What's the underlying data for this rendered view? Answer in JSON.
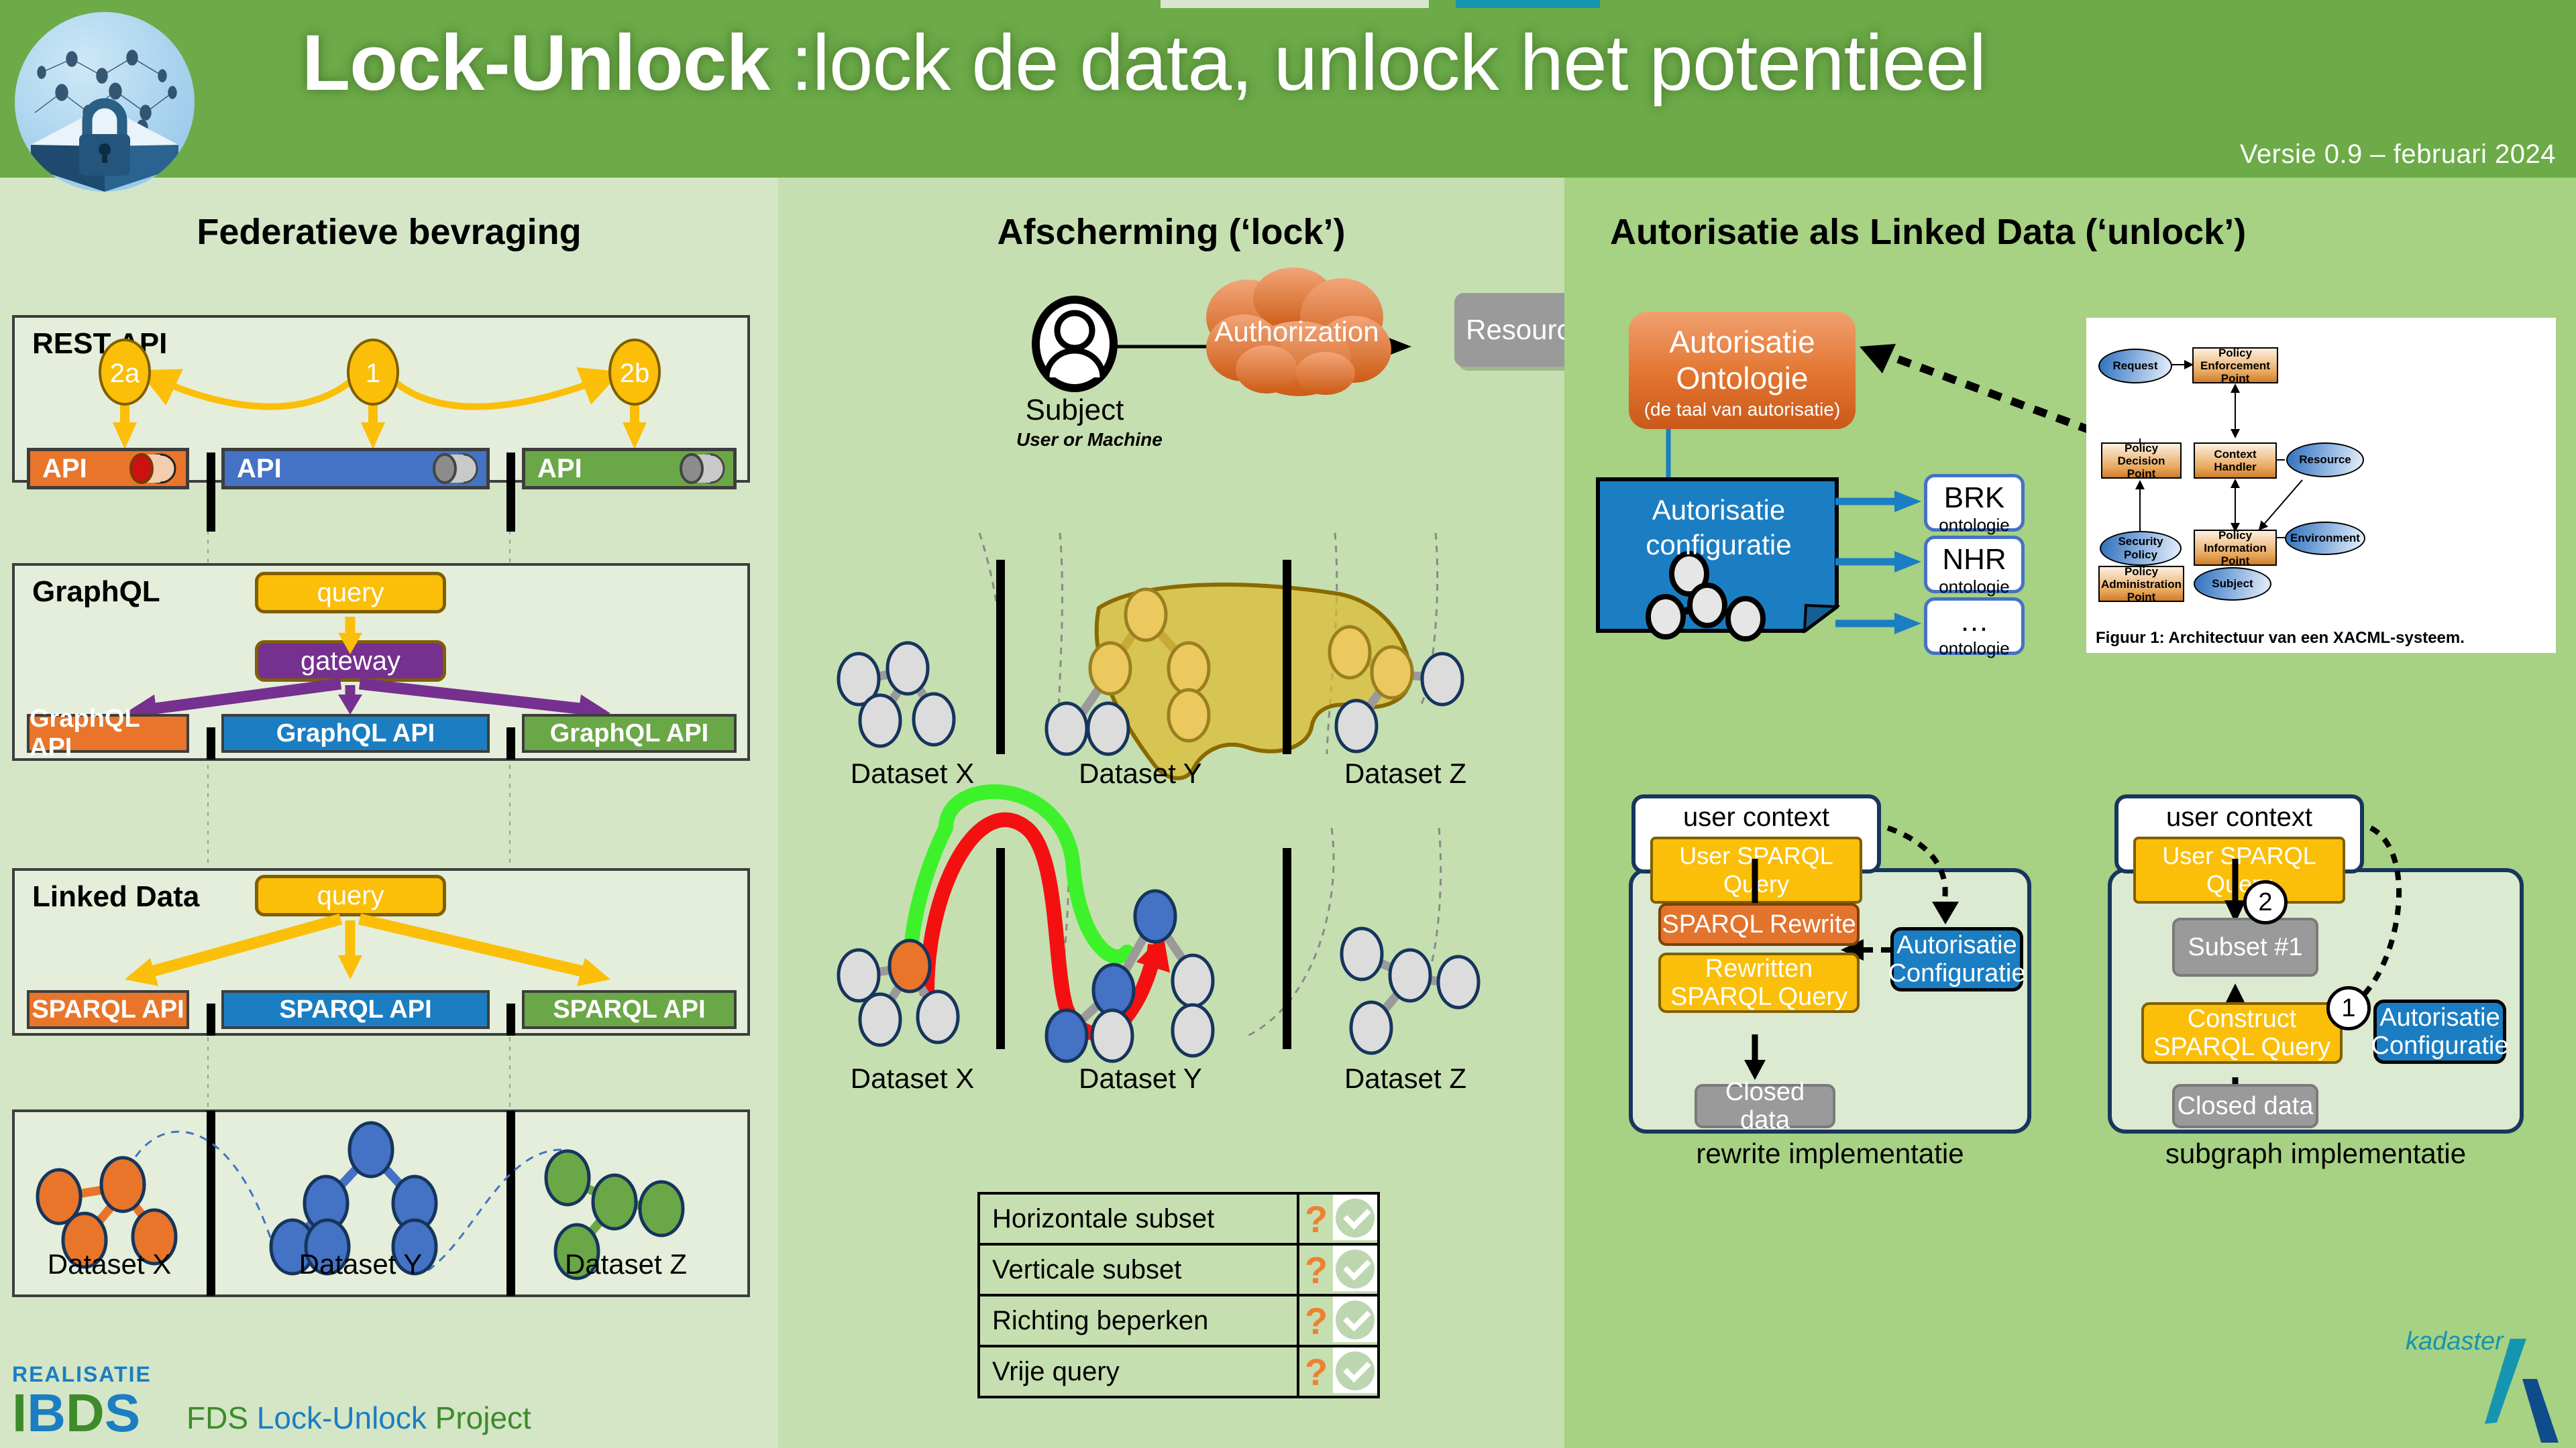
{
  "header": {
    "title_bold": "Lock-Unlock",
    "title_rest": " :lock de data, unlock het potentieel",
    "version": "Versie 0.9 – februari 2024",
    "logo_icon": "padlock-network-icon"
  },
  "columns": {
    "left": {
      "title": "Federatieve bevraging"
    },
    "mid": {
      "title": "Afscherming (‘lock’)"
    },
    "right": {
      "title": "Autorisatie als Linked Data (‘unlock’)"
    }
  },
  "rest_api": {
    "label": "REST API",
    "steps": [
      "2a",
      "1",
      "2b"
    ],
    "apis": [
      {
        "label": "API",
        "color": "#e8752a",
        "toggle": "red"
      },
      {
        "label": "API",
        "color": "#4472c4",
        "toggle": "grey"
      },
      {
        "label": "API",
        "color": "#6aa746",
        "toggle": "grey"
      }
    ]
  },
  "graphql": {
    "label": "GraphQL",
    "query": "query",
    "gateway": "gateway",
    "apis": [
      "GraphQL API",
      "GraphQL API",
      "GraphQL API"
    ]
  },
  "linked_data": {
    "label": "Linked Data",
    "query": "query",
    "apis": [
      "SPARQL API",
      "SPARQL API",
      "SPARQL API"
    ]
  },
  "datasets": {
    "labels": [
      "Dataset X",
      "Dataset Y",
      "Dataset Z"
    ],
    "colors": [
      "#e8752a",
      "#4472c4",
      "#6aa746"
    ]
  },
  "afscherming": {
    "subject": "Subject",
    "subject_sub": "User or Machine",
    "authorization": "Authorization",
    "resource": "Resource",
    "subject_icon": "person-avatar-icon",
    "cloud_icon": "cloud-icon"
  },
  "features_table": {
    "rows": [
      {
        "label": "Horizontale subset",
        "question": "?",
        "check": "✓"
      },
      {
        "label": "Verticale subset",
        "question": "?",
        "check": "✓"
      },
      {
        "label": "Richting beperken",
        "question": "?",
        "check": "✓"
      },
      {
        "label": "Vrije query",
        "question": "?",
        "check": "✓"
      }
    ]
  },
  "unlock": {
    "ontology_title_line1": "Autorisatie",
    "ontology_title_line2": "Ontologie",
    "ontology_sub": "(de taal van autorisatie)",
    "config_line1": "Autorisatie",
    "config_line2": "configuratie",
    "config_icon": "graph-nodes-icon",
    "ontologies": [
      {
        "name": "BRK",
        "sub": "ontologie"
      },
      {
        "name": "NHR",
        "sub": "ontologie"
      },
      {
        "name": "…",
        "sub": "ontologie"
      }
    ]
  },
  "xacml": {
    "caption": "Figuur 1: Architectuur van een XACML-systeem.",
    "nodes": [
      {
        "id": "request",
        "label": "Request",
        "shape": "ellipse"
      },
      {
        "id": "pep",
        "label": "Policy Enforcement Point",
        "shape": "box"
      },
      {
        "id": "pdp",
        "label": "Policy Decision Point",
        "shape": "box"
      },
      {
        "id": "ctx",
        "label": "Context Handler",
        "shape": "box"
      },
      {
        "id": "resource",
        "label": "Resource",
        "shape": "ellipse"
      },
      {
        "id": "secpol",
        "label": "Security Policy",
        "shape": "ellipse"
      },
      {
        "id": "pip",
        "label": "Policy Information Point",
        "shape": "box"
      },
      {
        "id": "env",
        "label": "Environment",
        "shape": "ellipse"
      },
      {
        "id": "pap",
        "label": "Policy Administration Point",
        "shape": "box"
      },
      {
        "id": "subject",
        "label": "Subject",
        "shape": "ellipse"
      }
    ]
  },
  "rewrite": {
    "user_context": "user context",
    "user_query": "User SPARQL Query",
    "step_boxes": [
      "SPARQL Rewrite",
      "Rewritten\nSPARQL Query",
      "Closed data"
    ],
    "rewrite_label": "SPARQL Rewrite",
    "rewritten_label_l1": "Rewritten",
    "rewritten_label_l2": "SPARQL Query",
    "closed_data": "Closed data",
    "auth_config_l1": "Autorisatie",
    "auth_config_l2": "Configuratie",
    "caption": "rewrite implementatie"
  },
  "subgraph": {
    "user_context": "user context",
    "user_query": "User SPARQL Query",
    "subset": "Subset #1",
    "construct_l1": "Construct",
    "construct_l2": "SPARQL Query",
    "closed_data": "Closed data",
    "auth_config_l1": "Autorisatie",
    "auth_config_l2": "Configuratie",
    "step1": "1",
    "step2": "2",
    "caption": "subgraph implementatie"
  },
  "footer": {
    "realisatie": "REALISATIE",
    "ibds_i": "I",
    "ibds_b": "B",
    "ibds_d": "D",
    "ibds_s": "S",
    "fds": "FDS ",
    "fds_mid": "Lock-Unlock ",
    "fds_end": "Project",
    "kadaster": "kadaster"
  },
  "colors": {
    "header_green": "#6cab48",
    "col_left_bg": "#d4e6c6",
    "col_mid_bg": "#c6dfb0",
    "col_right_bg": "#a7d183",
    "orange": "#e8752a",
    "blue": "#4472c4",
    "green": "#6aa746",
    "yellow": "#fbbf09",
    "purple": "#76308f",
    "grey": "#9a9a9a"
  }
}
